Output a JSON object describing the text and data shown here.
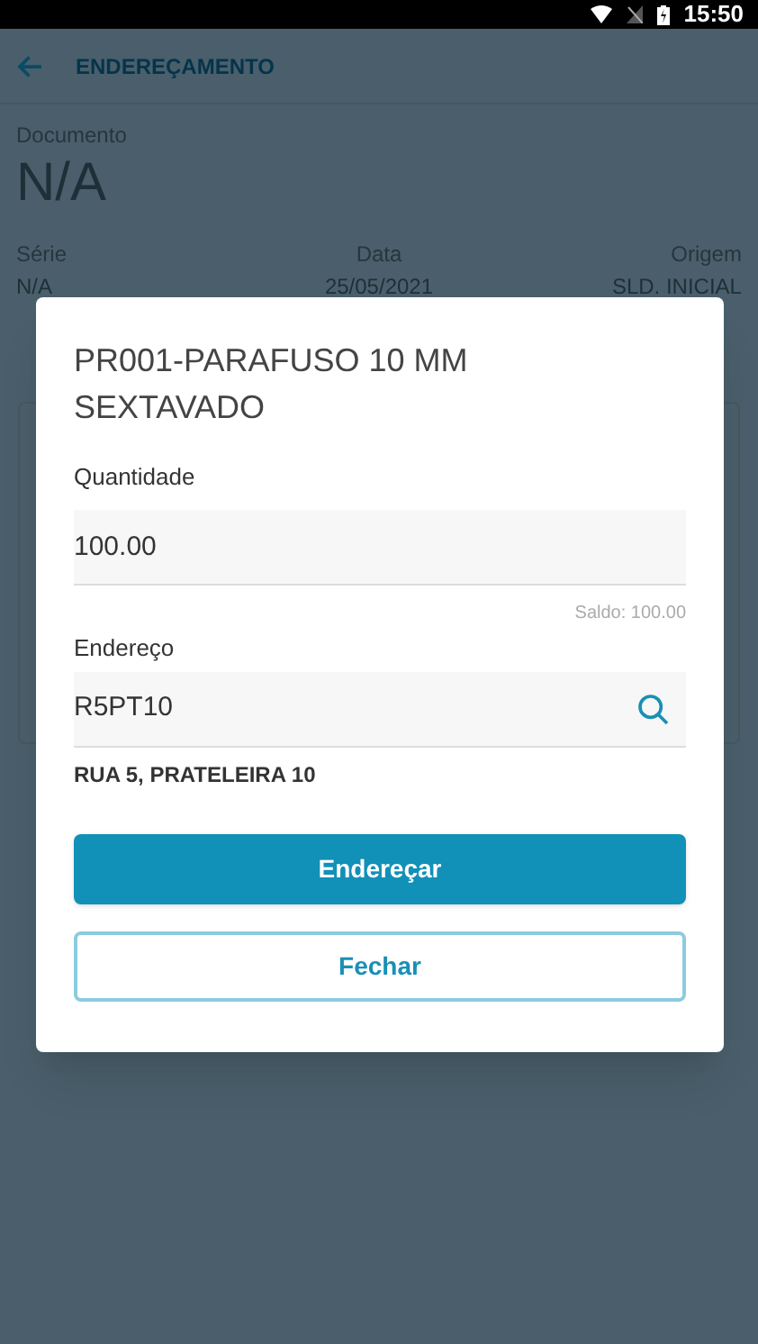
{
  "status_bar": {
    "time": "15:50"
  },
  "header": {
    "title": "ENDEREÇAMENTO"
  },
  "document": {
    "label": "Documento",
    "value": "N/A"
  },
  "details": [
    {
      "label": "Série",
      "value": "N/A"
    },
    {
      "label": "Data",
      "value": "25/05/2021"
    },
    {
      "label": "Origem",
      "value": "SLD. INICIAL"
    }
  ],
  "dialog": {
    "title": "PR001-PARAFUSO 10 MM SEXTAVADO",
    "quantity": {
      "label": "Quantidade",
      "value": "100.00",
      "hint": "Saldo: 100.00"
    },
    "address": {
      "label": "Endereço",
      "value": "R5PT10",
      "description": "RUA 5, PRATELEIRA 10"
    },
    "buttons": [
      {
        "label": "Endereçar",
        "kind": "primary"
      },
      {
        "label": "Fechar",
        "kind": "secondary"
      }
    ]
  }
}
